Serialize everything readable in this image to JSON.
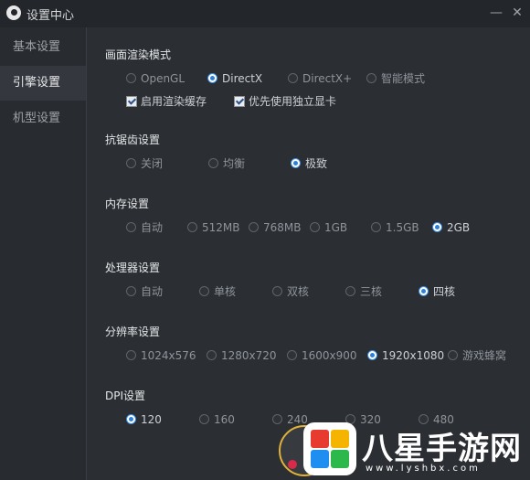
{
  "window": {
    "title": "设置中心",
    "minimize_glyph": "—",
    "close_glyph": "✕"
  },
  "sidebar": {
    "items": [
      {
        "label": "基本设置",
        "active": false
      },
      {
        "label": "引擎设置",
        "active": true
      },
      {
        "label": "机型设置",
        "active": false
      }
    ]
  },
  "sections": {
    "render": {
      "title": "画面渲染模式",
      "options": [
        "OpenGL",
        "DirectX",
        "DirectX+",
        "智能模式"
      ],
      "selected": "DirectX",
      "checkboxes": [
        {
          "label": "启用渲染缓存",
          "checked": true
        },
        {
          "label": "优先使用独立显卡",
          "checked": true
        }
      ]
    },
    "antialias": {
      "title": "抗锯齿设置",
      "options": [
        "关闭",
        "均衡",
        "极致"
      ],
      "selected": "极致"
    },
    "memory": {
      "title": "内存设置",
      "options": [
        "自动",
        "512MB",
        "768MB",
        "1GB",
        "1.5GB",
        "2GB"
      ],
      "selected": "2GB"
    },
    "cpu": {
      "title": "处理器设置",
      "options": [
        "自动",
        "单核",
        "双核",
        "三核",
        "四核"
      ],
      "selected": "四核"
    },
    "resolution": {
      "title": "分辨率设置",
      "options": [
        "1024x576",
        "1280x720",
        "1600x900",
        "1920x1080",
        "游戏蜂窝"
      ],
      "selected": "1920x1080"
    },
    "dpi": {
      "title": "DPI设置",
      "options": [
        "120",
        "160",
        "240",
        "320",
        "480"
      ],
      "selected": "120"
    }
  },
  "watermark": {
    "text": "八星手游网",
    "url": "www.lyshbx.com"
  },
  "colors": {
    "background": "#2b2e33",
    "sidebar": "#282b30",
    "accent": "#2f7fd9"
  }
}
